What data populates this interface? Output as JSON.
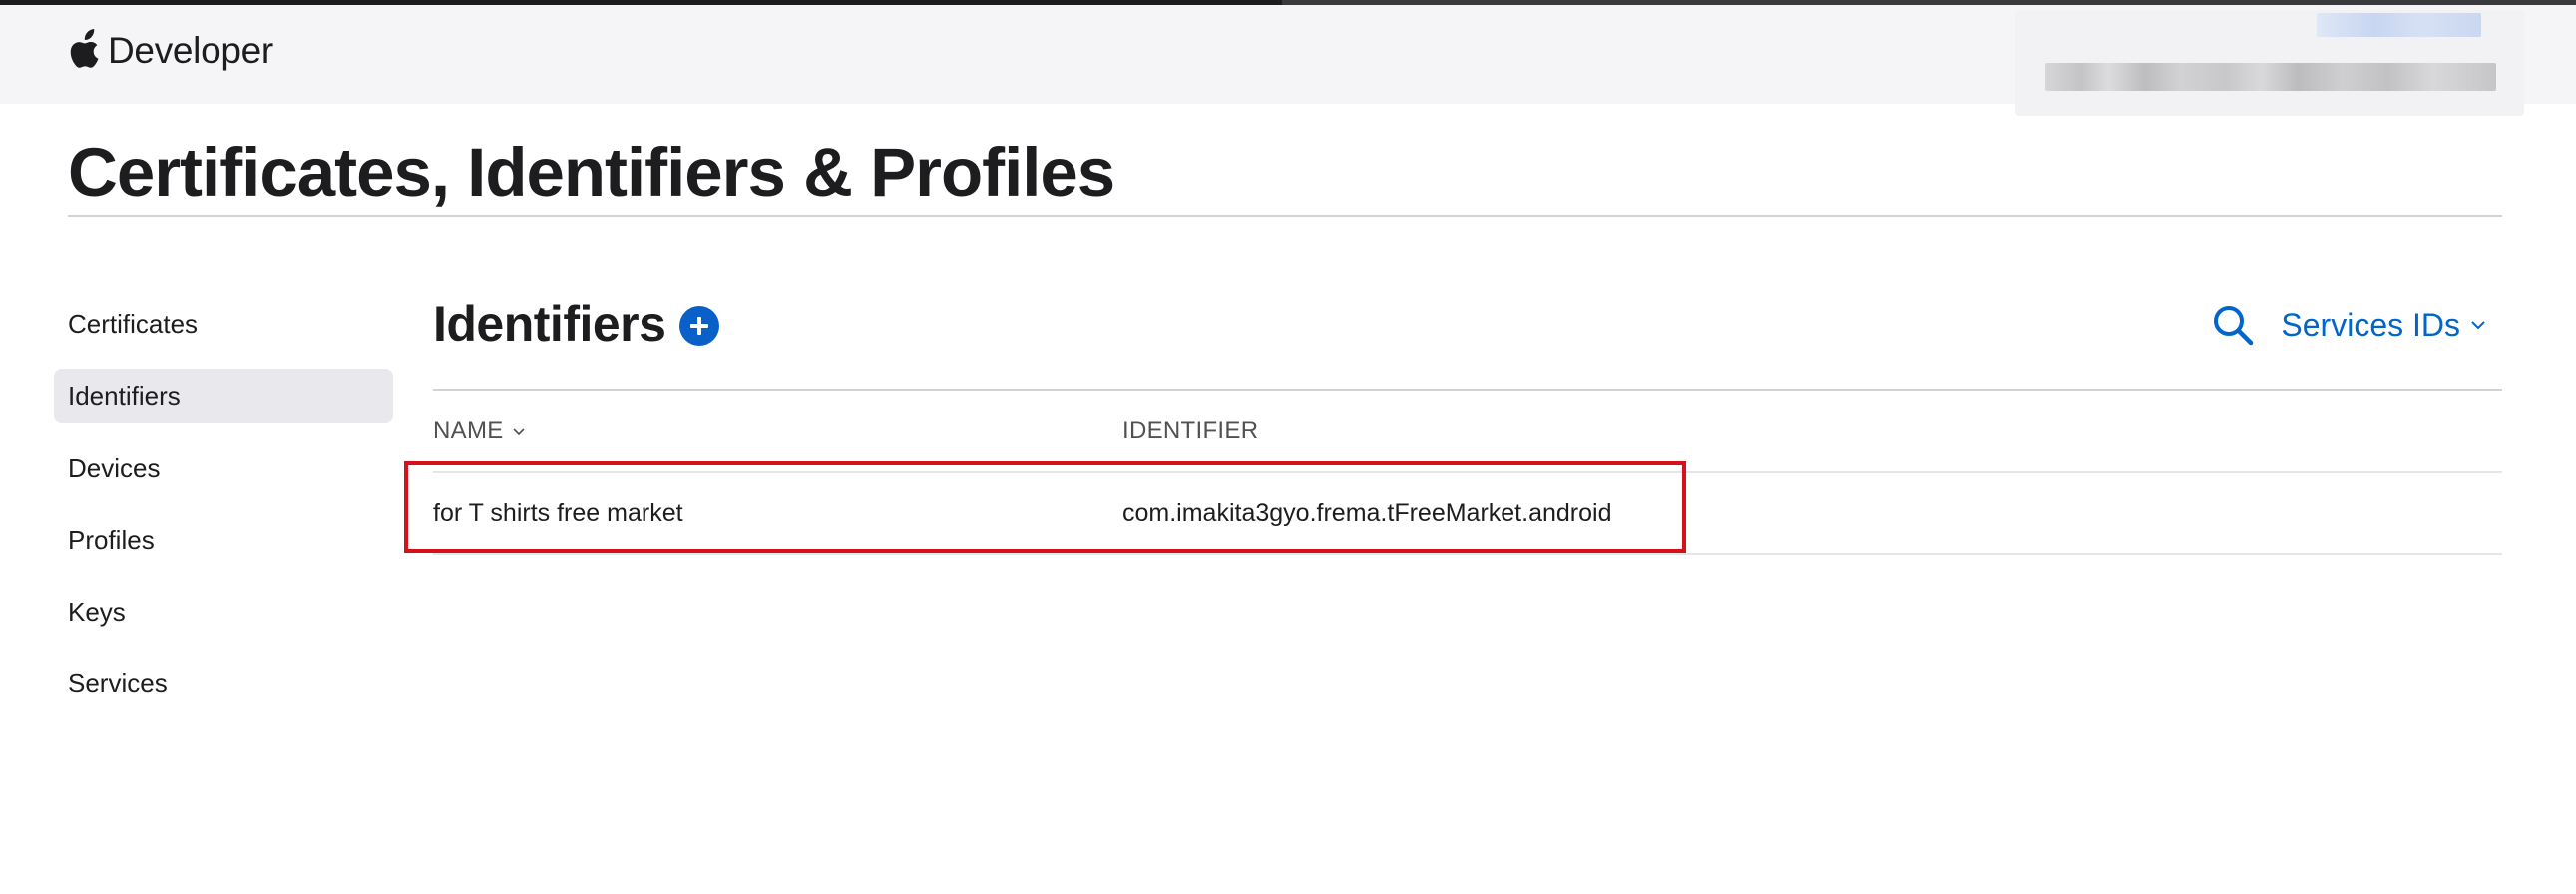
{
  "header": {
    "brand": "Developer"
  },
  "page": {
    "title": "Certificates, Identifiers & Profiles"
  },
  "sidebar": {
    "items": [
      {
        "label": "Certificates",
        "active": false
      },
      {
        "label": "Identifiers",
        "active": true
      },
      {
        "label": "Devices",
        "active": false
      },
      {
        "label": "Profiles",
        "active": false
      },
      {
        "label": "Keys",
        "active": false
      },
      {
        "label": "Services",
        "active": false
      }
    ]
  },
  "section": {
    "title": "Identifiers",
    "add_icon": "plus-circle-icon",
    "filter_label": "Services IDs",
    "search_icon": "search-icon"
  },
  "table": {
    "columns": [
      "NAME",
      "IDENTIFIER"
    ],
    "sort_column": "NAME",
    "rows": [
      {
        "name": "for T shirts free market",
        "identifier": "com.imakita3gyo.frema.tFreeMarket.android"
      }
    ]
  },
  "colors": {
    "accent": "#0066cc",
    "add_button": "#0a60c9",
    "highlight": "#d8101c",
    "active_nav": "#e8e8ed"
  }
}
